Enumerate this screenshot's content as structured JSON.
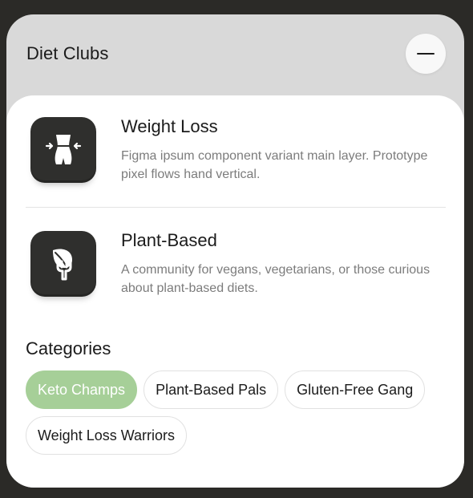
{
  "panel": {
    "title": "Diet Clubs",
    "collapse_icon": "minus-icon"
  },
  "clubs": [
    {
      "name": "Weight Loss",
      "description": "Figma ipsum component variant main layer. Prototype pixel flows hand vertical.",
      "icon": "waist-measure-icon"
    },
    {
      "name": "Plant-Based",
      "description": "A community for vegans, vegetarians, or those curious about plant-based diets.",
      "icon": "leaf-fork-icon"
    }
  ],
  "categories": {
    "title": "Categories",
    "items": [
      "Keto Champs",
      "Plant-Based Pals",
      "Gluten-Free Gang",
      "Weight Loss Warriors"
    ],
    "selected": "Keto Champs"
  },
  "colors": {
    "background": "#2b2a27",
    "panel": "#d9d9d9",
    "card": "#ffffff",
    "icon_tile": "#2f2f2d",
    "active_chip": "#a6cf98"
  }
}
